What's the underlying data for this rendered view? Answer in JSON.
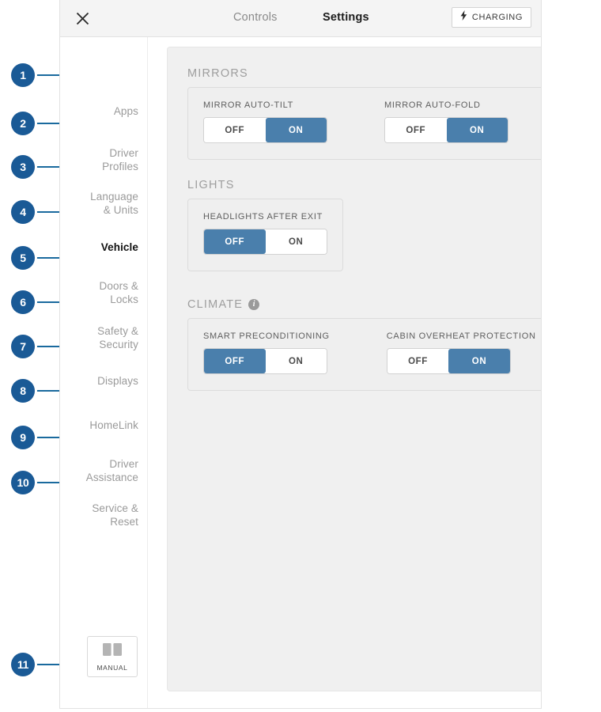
{
  "header": {
    "close_icon": "close-icon",
    "tab_controls": "Controls",
    "tab_settings": "Settings",
    "charging_label": "CHARGING",
    "charging_icon": "lightning-bolt-icon"
  },
  "sidebar": {
    "items": [
      {
        "label": "Apps",
        "active": false
      },
      {
        "label": "Driver\nProfiles",
        "active": false
      },
      {
        "label": "Language\n& Units",
        "active": false
      },
      {
        "label": "Vehicle",
        "active": true
      },
      {
        "label": "Doors &\nLocks",
        "active": false
      },
      {
        "label": "Safety &\nSecurity",
        "active": false
      },
      {
        "label": "Displays",
        "active": false
      },
      {
        "label": "HomeLink",
        "active": false
      },
      {
        "label": "Driver\nAssistance",
        "active": false
      },
      {
        "label": "Service &\nReset",
        "active": false
      }
    ],
    "manual_label": "MANUAL",
    "manual_icon": "open-book-icon"
  },
  "callouts": [
    {
      "number": "1"
    },
    {
      "number": "2"
    },
    {
      "number": "3"
    },
    {
      "number": "4"
    },
    {
      "number": "5"
    },
    {
      "number": "6"
    },
    {
      "number": "7"
    },
    {
      "number": "8"
    },
    {
      "number": "9"
    },
    {
      "number": "10"
    },
    {
      "number": "11"
    }
  ],
  "sections": [
    {
      "title": "MIRRORS",
      "has_info": false,
      "settings": [
        {
          "label": "MIRROR AUTO-TILT",
          "off_label": "OFF",
          "on_label": "ON",
          "value": "ON"
        },
        {
          "label": "MIRROR AUTO-FOLD",
          "off_label": "OFF",
          "on_label": "ON",
          "value": "ON"
        }
      ]
    },
    {
      "title": "LIGHTS",
      "has_info": false,
      "settings": [
        {
          "label": "HEADLIGHTS AFTER EXIT",
          "off_label": "OFF",
          "on_label": "ON",
          "value": "OFF"
        }
      ]
    },
    {
      "title": "CLIMATE",
      "has_info": true,
      "info_icon": "info-icon",
      "settings": [
        {
          "label": "SMART PRECONDITIONING",
          "off_label": "OFF",
          "on_label": "ON",
          "value": "OFF"
        },
        {
          "label": "CABIN OVERHEAT PROTECTION",
          "off_label": "OFF",
          "on_label": "ON",
          "value": "ON"
        }
      ]
    }
  ],
  "colors": {
    "badge_blue": "#1a5a96",
    "toggle_active_blue": "#4a7fac",
    "panel_grey": "#f0f0f0",
    "header_grey": "#f4f4f4"
  }
}
